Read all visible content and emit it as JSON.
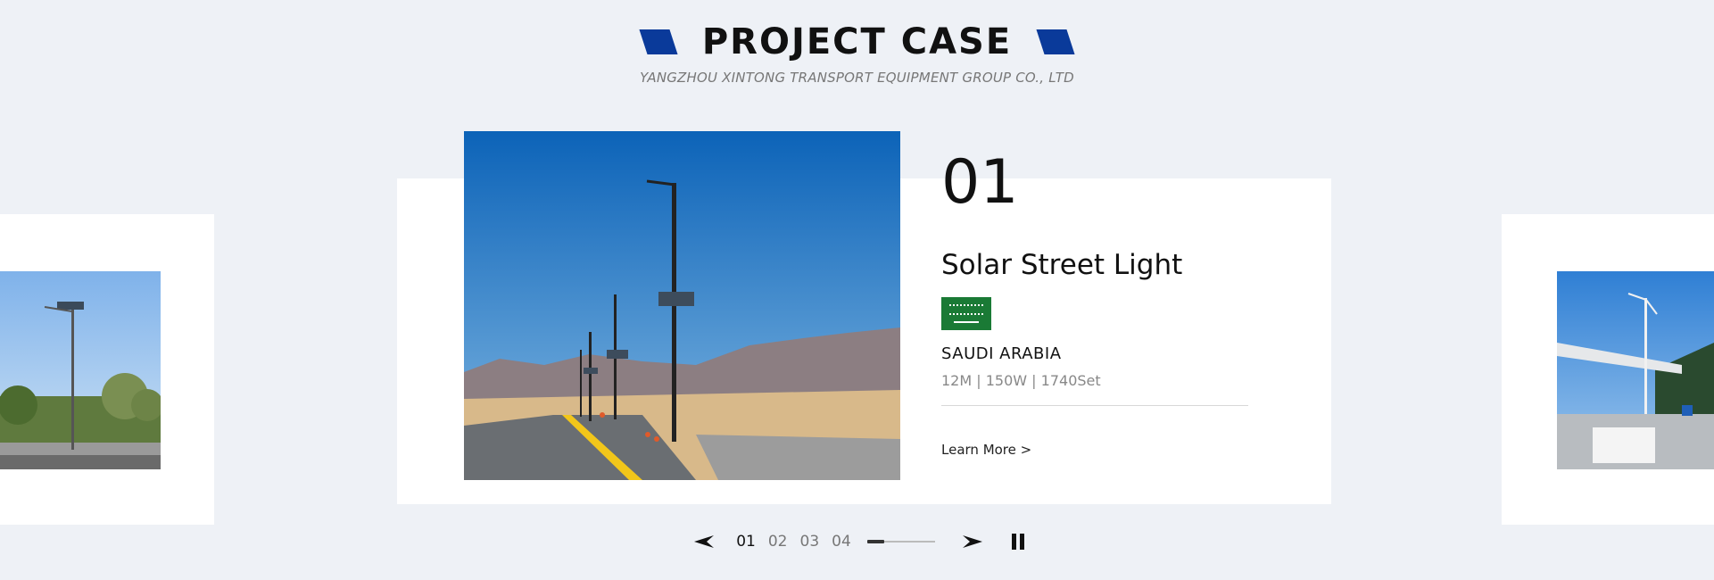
{
  "header": {
    "title": "PROJECT CASE",
    "subtitle": "YANGZHOU XINTONG TRANSPORT EQUIPMENT GROUP CO., LTD",
    "accent_color": "#0a3a9a"
  },
  "main_slide": {
    "number": "01",
    "title": "Solar Street Light",
    "flag_icon": "saudi-arabia-flag-icon",
    "country": "SAUDI ARABIA",
    "specs": "12M | 150W | 1740Set",
    "learn_more": "Learn More >"
  },
  "pager": {
    "prev_icon": "arrow-left-icon",
    "next_icon": "arrow-right-icon",
    "pages": [
      "01",
      "02",
      "03",
      "04"
    ],
    "active_index": 0,
    "progress": 0.25,
    "pause_icon": "pause-icon"
  }
}
